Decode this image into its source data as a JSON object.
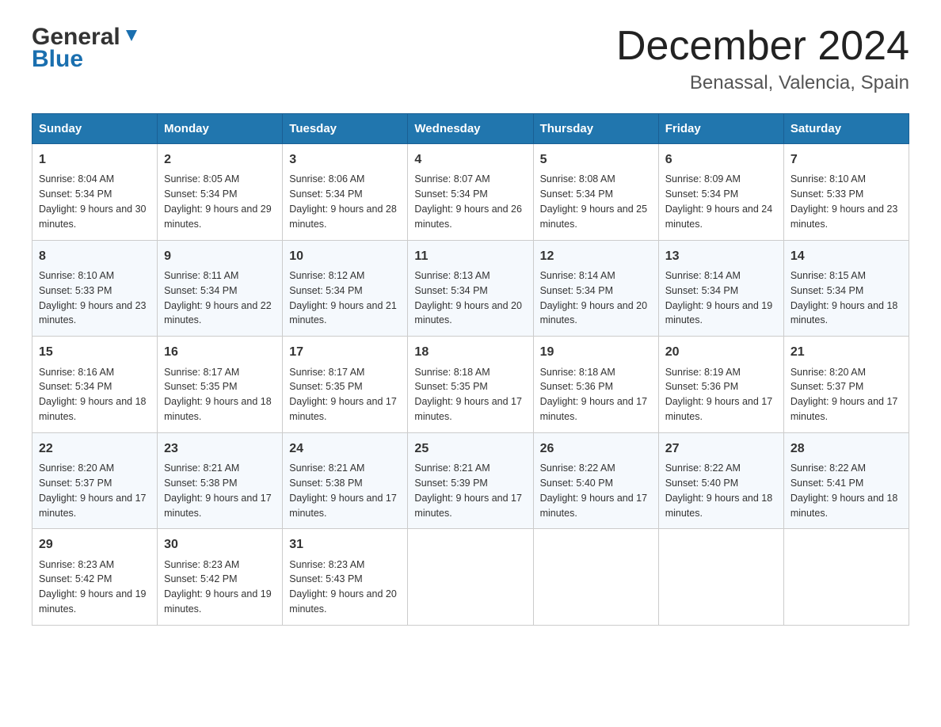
{
  "header": {
    "logo_general": "General",
    "logo_blue": "Blue",
    "month_title": "December 2024",
    "location": "Benassal, Valencia, Spain"
  },
  "days_of_week": [
    "Sunday",
    "Monday",
    "Tuesday",
    "Wednesday",
    "Thursday",
    "Friday",
    "Saturday"
  ],
  "weeks": [
    [
      {
        "num": "1",
        "sunrise": "8:04 AM",
        "sunset": "5:34 PM",
        "daylight": "9 hours and 30 minutes."
      },
      {
        "num": "2",
        "sunrise": "8:05 AM",
        "sunset": "5:34 PM",
        "daylight": "9 hours and 29 minutes."
      },
      {
        "num": "3",
        "sunrise": "8:06 AM",
        "sunset": "5:34 PM",
        "daylight": "9 hours and 28 minutes."
      },
      {
        "num": "4",
        "sunrise": "8:07 AM",
        "sunset": "5:34 PM",
        "daylight": "9 hours and 26 minutes."
      },
      {
        "num": "5",
        "sunrise": "8:08 AM",
        "sunset": "5:34 PM",
        "daylight": "9 hours and 25 minutes."
      },
      {
        "num": "6",
        "sunrise": "8:09 AM",
        "sunset": "5:34 PM",
        "daylight": "9 hours and 24 minutes."
      },
      {
        "num": "7",
        "sunrise": "8:10 AM",
        "sunset": "5:33 PM",
        "daylight": "9 hours and 23 minutes."
      }
    ],
    [
      {
        "num": "8",
        "sunrise": "8:10 AM",
        "sunset": "5:33 PM",
        "daylight": "9 hours and 23 minutes."
      },
      {
        "num": "9",
        "sunrise": "8:11 AM",
        "sunset": "5:34 PM",
        "daylight": "9 hours and 22 minutes."
      },
      {
        "num": "10",
        "sunrise": "8:12 AM",
        "sunset": "5:34 PM",
        "daylight": "9 hours and 21 minutes."
      },
      {
        "num": "11",
        "sunrise": "8:13 AM",
        "sunset": "5:34 PM",
        "daylight": "9 hours and 20 minutes."
      },
      {
        "num": "12",
        "sunrise": "8:14 AM",
        "sunset": "5:34 PM",
        "daylight": "9 hours and 20 minutes."
      },
      {
        "num": "13",
        "sunrise": "8:14 AM",
        "sunset": "5:34 PM",
        "daylight": "9 hours and 19 minutes."
      },
      {
        "num": "14",
        "sunrise": "8:15 AM",
        "sunset": "5:34 PM",
        "daylight": "9 hours and 18 minutes."
      }
    ],
    [
      {
        "num": "15",
        "sunrise": "8:16 AM",
        "sunset": "5:34 PM",
        "daylight": "9 hours and 18 minutes."
      },
      {
        "num": "16",
        "sunrise": "8:17 AM",
        "sunset": "5:35 PM",
        "daylight": "9 hours and 18 minutes."
      },
      {
        "num": "17",
        "sunrise": "8:17 AM",
        "sunset": "5:35 PM",
        "daylight": "9 hours and 17 minutes."
      },
      {
        "num": "18",
        "sunrise": "8:18 AM",
        "sunset": "5:35 PM",
        "daylight": "9 hours and 17 minutes."
      },
      {
        "num": "19",
        "sunrise": "8:18 AM",
        "sunset": "5:36 PM",
        "daylight": "9 hours and 17 minutes."
      },
      {
        "num": "20",
        "sunrise": "8:19 AM",
        "sunset": "5:36 PM",
        "daylight": "9 hours and 17 minutes."
      },
      {
        "num": "21",
        "sunrise": "8:20 AM",
        "sunset": "5:37 PM",
        "daylight": "9 hours and 17 minutes."
      }
    ],
    [
      {
        "num": "22",
        "sunrise": "8:20 AM",
        "sunset": "5:37 PM",
        "daylight": "9 hours and 17 minutes."
      },
      {
        "num": "23",
        "sunrise": "8:21 AM",
        "sunset": "5:38 PM",
        "daylight": "9 hours and 17 minutes."
      },
      {
        "num": "24",
        "sunrise": "8:21 AM",
        "sunset": "5:38 PM",
        "daylight": "9 hours and 17 minutes."
      },
      {
        "num": "25",
        "sunrise": "8:21 AM",
        "sunset": "5:39 PM",
        "daylight": "9 hours and 17 minutes."
      },
      {
        "num": "26",
        "sunrise": "8:22 AM",
        "sunset": "5:40 PM",
        "daylight": "9 hours and 17 minutes."
      },
      {
        "num": "27",
        "sunrise": "8:22 AM",
        "sunset": "5:40 PM",
        "daylight": "9 hours and 18 minutes."
      },
      {
        "num": "28",
        "sunrise": "8:22 AM",
        "sunset": "5:41 PM",
        "daylight": "9 hours and 18 minutes."
      }
    ],
    [
      {
        "num": "29",
        "sunrise": "8:23 AM",
        "sunset": "5:42 PM",
        "daylight": "9 hours and 19 minutes."
      },
      {
        "num": "30",
        "sunrise": "8:23 AM",
        "sunset": "5:42 PM",
        "daylight": "9 hours and 19 minutes."
      },
      {
        "num": "31",
        "sunrise": "8:23 AM",
        "sunset": "5:43 PM",
        "daylight": "9 hours and 20 minutes."
      },
      null,
      null,
      null,
      null
    ]
  ],
  "labels": {
    "sunrise": "Sunrise:",
    "sunset": "Sunset:",
    "daylight": "Daylight:"
  }
}
